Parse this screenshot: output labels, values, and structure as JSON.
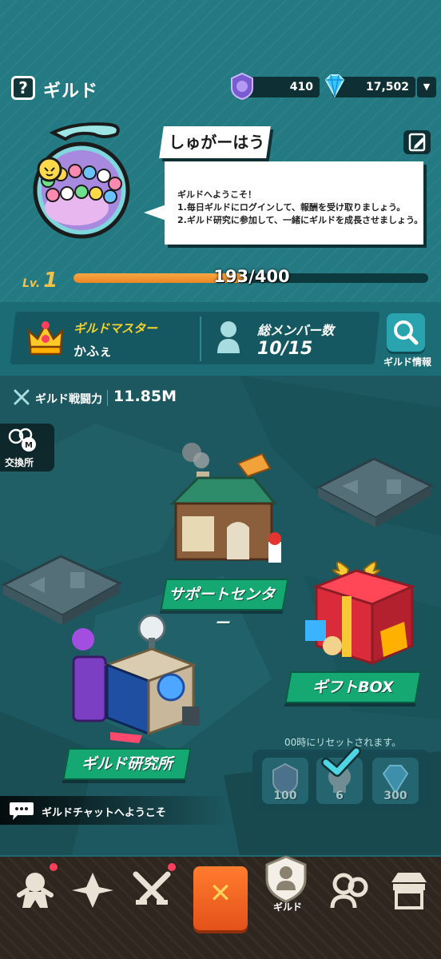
{
  "header": {
    "help_icon": "question-icon",
    "title": "ギルド",
    "medals": "410",
    "gems": "17,502",
    "dropdown_icon": "caret-down-icon"
  },
  "guild": {
    "name": "しゅがーはうす",
    "welcome_lines": [
      "ギルドへようこそ！",
      "1.毎日ギルドにログインして、報酬を受け取りましょう。",
      "2.ギルド研究に参加して、一緒にギルドを成長させましょう。"
    ],
    "level_prefix": "Lv.",
    "level": "1",
    "xp_text": "193/400",
    "xp_fraction": 0.4825
  },
  "info": {
    "master_label": "ギルドマスター",
    "master_name": "かふぇ",
    "members_label": "総メンバー数",
    "members_value": "10/15",
    "info_button": "ギルド情報"
  },
  "map": {
    "power_label": "ギルド戦闘力",
    "power_value": "11.85M",
    "exchange_label": "交換所",
    "support_center": "サポートセンター",
    "gift_box": "ギフトBOX",
    "research_lab": "ギルド研究所",
    "reset_note": "00時にリセットされます。",
    "rewards": [
      {
        "icon": "medal-icon",
        "amount": "100"
      },
      {
        "icon": "skull-icon",
        "amount": "6"
      },
      {
        "icon": "gem-icon",
        "amount": "300"
      }
    ]
  },
  "chat": {
    "text": "ギルドチャットへようこそ"
  },
  "nav": {
    "guild_label": "ギルド"
  },
  "colors": {
    "accent_orange": "#ec8722",
    "label_green": "#16a873",
    "master_yellow": "#f5d22e"
  }
}
